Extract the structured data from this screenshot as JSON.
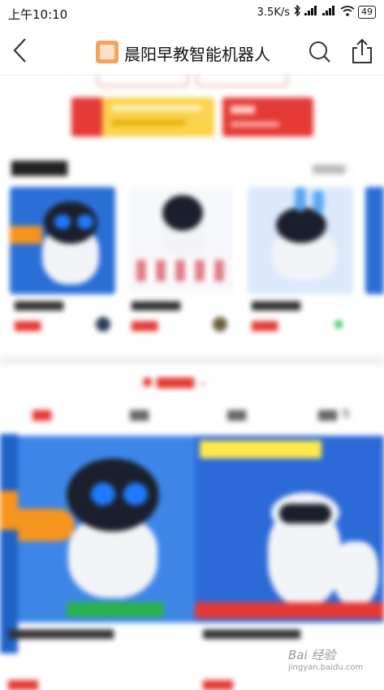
{
  "status_bar": {
    "time": "上午10:10",
    "network_speed": "3.5K/s",
    "battery_level": "49"
  },
  "nav": {
    "shop_title": "晨阳早教智能机器人"
  },
  "watermark": {
    "text": "Bai 经验",
    "subtext": "jingyan.baidu.com"
  },
  "colors": {
    "accent_red": "#e53935",
    "coupon_yellow": "#fbd24b",
    "banner_blue": "#1f63c9"
  }
}
